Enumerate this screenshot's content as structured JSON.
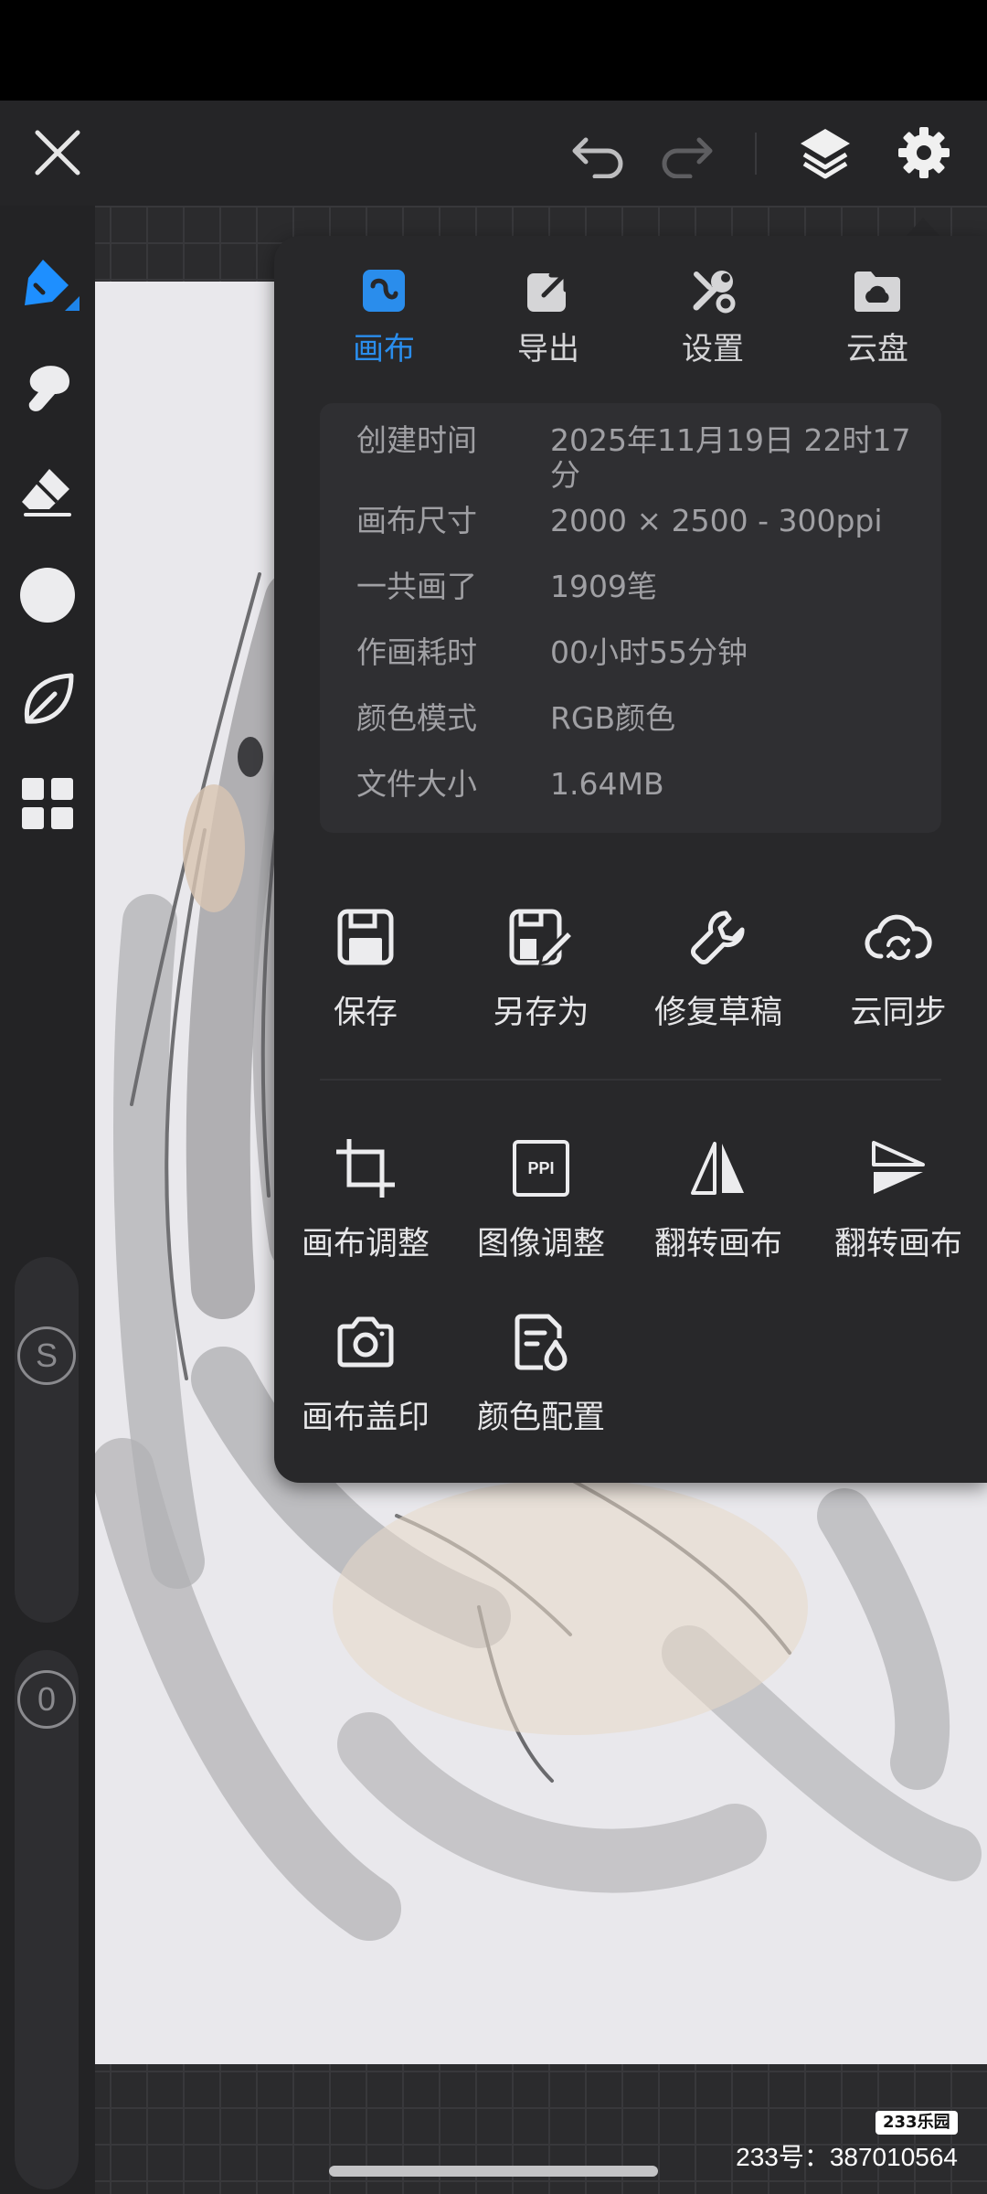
{
  "tabs": [
    {
      "label": "画布",
      "icon": "canvas-icon",
      "active": true
    },
    {
      "label": "导出",
      "icon": "export-icon",
      "active": false
    },
    {
      "label": "设置",
      "icon": "tools-icon",
      "active": false
    },
    {
      "label": "云盘",
      "icon": "cloud-drive-icon",
      "active": false
    }
  ],
  "info": [
    {
      "key": "创建时间",
      "value": "2025年11月19日 22时17分"
    },
    {
      "key": "画布尺寸",
      "value": "2000 × 2500 - 300ppi"
    },
    {
      "key": "一共画了",
      "value": "1909笔"
    },
    {
      "key": "作画耗时",
      "value": "00小时55分钟"
    },
    {
      "key": "颜色模式",
      "value": "RGB颜色"
    },
    {
      "key": "文件大小",
      "value": "1.64MB"
    }
  ],
  "actions": [
    {
      "label": "保存",
      "icon": "save-icon"
    },
    {
      "label": "另存为",
      "icon": "save-as-icon"
    },
    {
      "label": "修复草稿",
      "icon": "wrench-icon"
    },
    {
      "label": "云同步",
      "icon": "cloud-sync-icon"
    }
  ],
  "adjustments": [
    {
      "label": "画布调整",
      "icon": "crop-icon"
    },
    {
      "label": "图像调整",
      "icon": "ppi-icon",
      "icon_text": "PPI"
    },
    {
      "label": "翻转画布",
      "icon": "flip-horizontal-icon"
    },
    {
      "label": "翻转画布",
      "icon": "flip-vertical-icon"
    },
    {
      "label": "画布盖印",
      "icon": "camera-icon"
    },
    {
      "label": "颜色配置",
      "icon": "color-config-icon"
    }
  ],
  "left_toolbar": {
    "size_knob": "S",
    "opacity_knob": "0",
    "active_color": "#1e8fff"
  },
  "watermark": {
    "logo": "233乐园",
    "id": "233号：387010564"
  },
  "colors": {
    "accent": "#2a8dec",
    "panel": "#28282a",
    "toolbar": "#252527"
  }
}
